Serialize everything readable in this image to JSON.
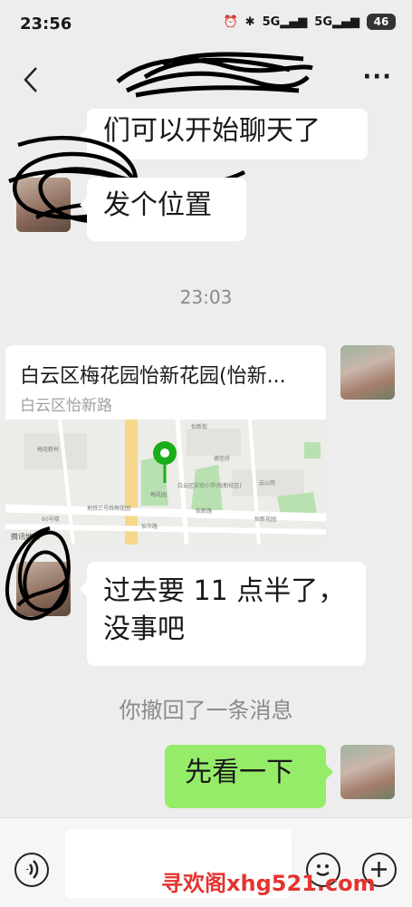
{
  "status_bar": {
    "time": "23:56",
    "net1": "5G",
    "net2": "5G",
    "battery": "46"
  },
  "header": {
    "title": "",
    "back_label": "<",
    "more_label": "···"
  },
  "messages": {
    "m1": "们可以开始聊天了",
    "m2": "发个位置",
    "timestamp": "23:03",
    "location_title": "白云区梅花园怡新花园(怡新...",
    "location_address": "白云区怡新路",
    "m3_line1": "过去要 11 点半了，",
    "m3_line2": "没事吧",
    "recall_note": "你撤回了一条消息",
    "m4": "先看一下"
  },
  "map_labels": {
    "a": "梅花园",
    "b": "怡新街",
    "c": "白云区实验小学(怡新校区)",
    "d": "德信府",
    "e": "云山苑",
    "f": "怡新路",
    "g": "地铁三号线梅花园",
    "h": "怡华路",
    "i": "怡新花园",
    "j": "60号楼",
    "k": "梅花新村",
    "l": "腾讯地图"
  },
  "watermark": "寻欢阁xhg521.com"
}
